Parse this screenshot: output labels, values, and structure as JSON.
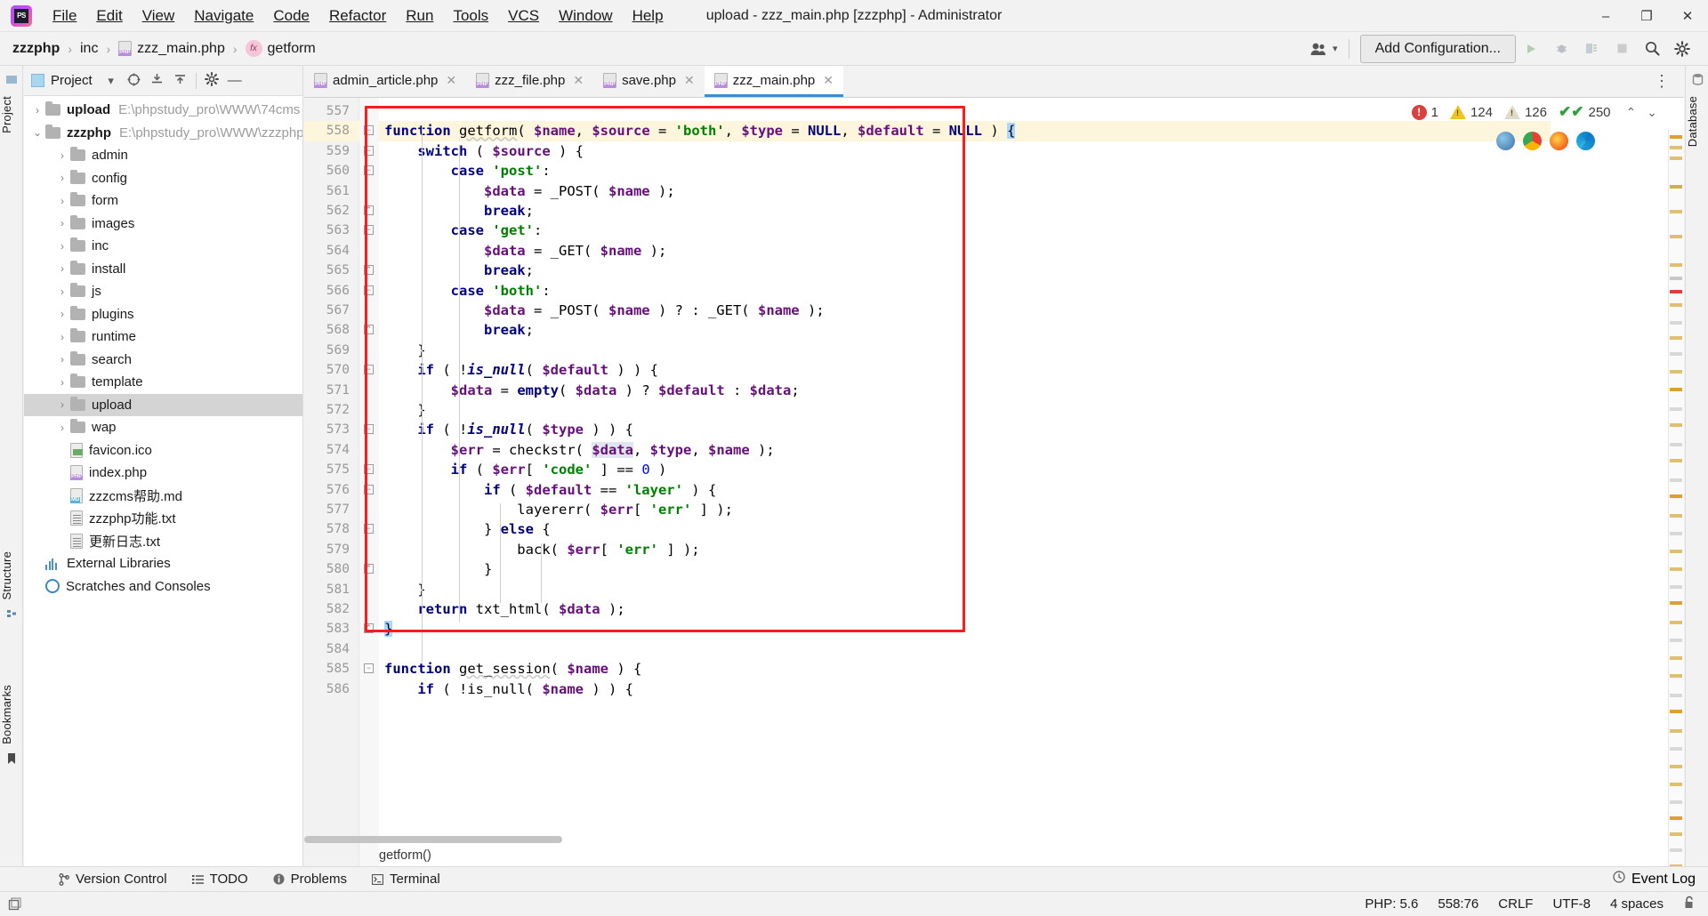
{
  "window": {
    "title": "upload - zzz_main.php [zzzphp] - Administrator",
    "logo_text": "PS",
    "minimize": "–",
    "maximize": "❐",
    "close": "✕"
  },
  "menu": [
    {
      "label": "File"
    },
    {
      "label": "Edit"
    },
    {
      "label": "View"
    },
    {
      "label": "Navigate"
    },
    {
      "label": "Code"
    },
    {
      "label": "Refactor"
    },
    {
      "label": "Run"
    },
    {
      "label": "Tools"
    },
    {
      "label": "VCS"
    },
    {
      "label": "Window"
    },
    {
      "label": "Help"
    }
  ],
  "navbar": {
    "breadcrumbs": [
      {
        "label": "zzzphp",
        "icon": "",
        "bold": true
      },
      {
        "label": "inc",
        "icon": ""
      },
      {
        "label": "zzz_main.php",
        "icon": "php-file-icon"
      },
      {
        "label": "getform",
        "icon": "function-icon"
      }
    ],
    "separator": "›",
    "people_icon": "👥",
    "people_chevron": "▾",
    "add_configuration": "Add Configuration...",
    "run_icon": "▶",
    "debug_icon": "🐞",
    "coverage_icon": "▤",
    "stop_icon": "■",
    "search_icon": "🔍",
    "settings_icon": "⚙"
  },
  "rail_left": {
    "project_label": "Project",
    "structure_label": "Structure",
    "bookmarks_label": "Bookmarks",
    "structure_icon": "☰",
    "bookmarks_icon": "🔖"
  },
  "rail_right": {
    "database_label": "Database"
  },
  "project_panel": {
    "title": "Project",
    "chevron": "▾",
    "icons": {
      "locate": "⊕",
      "expand": "⩟",
      "collapse": "⩠",
      "gear": "⚙",
      "hide": "—"
    },
    "tree": [
      {
        "label": "upload",
        "path": "E:\\phpstudy_pro\\WWW\\74cms",
        "type": "root-folder",
        "twist": "›",
        "depth": 0,
        "bold": true
      },
      {
        "label": "zzzphp",
        "path": "E:\\phpstudy_pro\\WWW\\zzzphp",
        "type": "root-folder",
        "twist": "⌄",
        "depth": 0,
        "bold": true
      },
      {
        "label": "admin",
        "type": "folder",
        "twist": "›",
        "depth": 1
      },
      {
        "label": "config",
        "type": "folder",
        "twist": "›",
        "depth": 1
      },
      {
        "label": "form",
        "type": "folder",
        "twist": "›",
        "depth": 1
      },
      {
        "label": "images",
        "type": "folder",
        "twist": "›",
        "depth": 1
      },
      {
        "label": "inc",
        "type": "folder",
        "twist": "›",
        "depth": 1
      },
      {
        "label": "install",
        "type": "folder",
        "twist": "›",
        "depth": 1
      },
      {
        "label": "js",
        "type": "folder",
        "twist": "›",
        "depth": 1
      },
      {
        "label": "plugins",
        "type": "folder",
        "twist": "›",
        "depth": 1
      },
      {
        "label": "runtime",
        "type": "folder",
        "twist": "›",
        "depth": 1
      },
      {
        "label": "search",
        "type": "folder",
        "twist": "›",
        "depth": 1
      },
      {
        "label": "template",
        "type": "folder",
        "twist": "›",
        "depth": 1
      },
      {
        "label": "upload",
        "type": "folder",
        "twist": "›",
        "depth": 1,
        "selected": true
      },
      {
        "label": "wap",
        "type": "folder",
        "twist": "›",
        "depth": 1
      },
      {
        "label": "favicon.ico",
        "type": "file-img",
        "ext": "",
        "depth": 1
      },
      {
        "label": "index.php",
        "type": "file-php",
        "ext": "PHP",
        "depth": 1
      },
      {
        "label": "zzzcms帮助.md",
        "type": "file-md",
        "ext": "MD",
        "depth": 1
      },
      {
        "label": "zzzphp功能.txt",
        "type": "file-txt",
        "ext": "",
        "depth": 1
      },
      {
        "label": "更新日志.txt",
        "type": "file-txt",
        "ext": "",
        "depth": 1
      },
      {
        "label": "External Libraries",
        "type": "libraries",
        "depth": 0
      },
      {
        "label": "Scratches and Consoles",
        "type": "scratches",
        "depth": 0
      }
    ]
  },
  "tabs": [
    {
      "label": "admin_article.php",
      "icon": "php-file-icon",
      "close": "✕",
      "active": false
    },
    {
      "label": "zzz_file.php",
      "icon": "php-file-icon",
      "close": "✕",
      "active": false
    },
    {
      "label": "save.php",
      "icon": "php-file-icon",
      "close": "✕",
      "active": false
    },
    {
      "label": "zzz_main.php",
      "icon": "php-file-icon",
      "close": "✕",
      "active": true
    }
  ],
  "tabbar_more_icon": "⋮",
  "inspection_widget": {
    "error_icon": "!",
    "errors": "1",
    "warning_icon": "▲",
    "warnings": "124",
    "weak_warning_icon": "▲",
    "weak_warnings": "126",
    "ok_icon": "✔✔",
    "typos": "250",
    "prev_icon": "⌃",
    "next_icon": "⌄"
  },
  "browser_icons": [
    "ie-icon",
    "chrome-icon",
    "firefox-icon",
    "edge-icon"
  ],
  "editor": {
    "first_line_number": 557,
    "lines": [
      {
        "n": 557,
        "tokens": []
      },
      {
        "n": 558,
        "highlight": true,
        "tokens": [
          {
            "t": "function ",
            "c": "k"
          },
          {
            "t": "getform",
            "c": "fu"
          },
          {
            "t": "( ",
            "c": "p"
          },
          {
            "t": "$name",
            "c": "v"
          },
          {
            "t": ", ",
            "c": "p"
          },
          {
            "t": "$source",
            "c": "v"
          },
          {
            "t": " = ",
            "c": "p"
          },
          {
            "t": "'both'",
            "c": "s"
          },
          {
            "t": ", ",
            "c": "p"
          },
          {
            "t": "$type",
            "c": "v"
          },
          {
            "t": " = ",
            "c": "p"
          },
          {
            "t": "NULL",
            "c": "k"
          },
          {
            "t": ", ",
            "c": "p"
          },
          {
            "t": "$default",
            "c": "v"
          },
          {
            "t": " = ",
            "c": "p"
          },
          {
            "t": "NULL",
            "c": "k"
          },
          {
            "t": " ) ",
            "c": "p"
          },
          {
            "t": "{",
            "c": "curly-hl"
          }
        ]
      },
      {
        "n": 559,
        "tokens": [
          {
            "t": "    ",
            "c": "p"
          },
          {
            "t": "switch",
            "c": "k"
          },
          {
            "t": " ( ",
            "c": "p"
          },
          {
            "t": "$source",
            "c": "v"
          },
          {
            "t": " ) {",
            "c": "p"
          }
        ]
      },
      {
        "n": 560,
        "tokens": [
          {
            "t": "        ",
            "c": "p"
          },
          {
            "t": "case",
            "c": "k"
          },
          {
            "t": " ",
            "c": "p"
          },
          {
            "t": "'post'",
            "c": "s"
          },
          {
            "t": ":",
            "c": "p"
          }
        ]
      },
      {
        "n": 561,
        "tokens": [
          {
            "t": "            ",
            "c": "p"
          },
          {
            "t": "$data",
            "c": "v"
          },
          {
            "t": " = _POST( ",
            "c": "p"
          },
          {
            "t": "$name",
            "c": "v"
          },
          {
            "t": " );",
            "c": "p"
          }
        ]
      },
      {
        "n": 562,
        "tokens": [
          {
            "t": "            ",
            "c": "p"
          },
          {
            "t": "break",
            "c": "k"
          },
          {
            "t": ";",
            "c": "p"
          }
        ]
      },
      {
        "n": 563,
        "tokens": [
          {
            "t": "        ",
            "c": "p"
          },
          {
            "t": "case",
            "c": "k"
          },
          {
            "t": " ",
            "c": "p"
          },
          {
            "t": "'get'",
            "c": "s"
          },
          {
            "t": ":",
            "c": "p"
          }
        ]
      },
      {
        "n": 564,
        "tokens": [
          {
            "t": "            ",
            "c": "p"
          },
          {
            "t": "$data",
            "c": "v"
          },
          {
            "t": " = _GET( ",
            "c": "p"
          },
          {
            "t": "$name",
            "c": "v"
          },
          {
            "t": " );",
            "c": "p"
          }
        ]
      },
      {
        "n": 565,
        "tokens": [
          {
            "t": "            ",
            "c": "p"
          },
          {
            "t": "break",
            "c": "k"
          },
          {
            "t": ";",
            "c": "p"
          }
        ]
      },
      {
        "n": 566,
        "tokens": [
          {
            "t": "        ",
            "c": "p"
          },
          {
            "t": "case",
            "c": "k"
          },
          {
            "t": " ",
            "c": "p"
          },
          {
            "t": "'both'",
            "c": "s"
          },
          {
            "t": ":",
            "c": "p"
          }
        ]
      },
      {
        "n": 567,
        "tokens": [
          {
            "t": "            ",
            "c": "p"
          },
          {
            "t": "$data",
            "c": "v"
          },
          {
            "t": " = _POST( ",
            "c": "p"
          },
          {
            "t": "$name",
            "c": "v"
          },
          {
            "t": " ) ? : _GET( ",
            "c": "p"
          },
          {
            "t": "$name",
            "c": "v"
          },
          {
            "t": " );",
            "c": "p"
          }
        ]
      },
      {
        "n": 568,
        "tokens": [
          {
            "t": "            ",
            "c": "p"
          },
          {
            "t": "break",
            "c": "k"
          },
          {
            "t": ";",
            "c": "p"
          }
        ]
      },
      {
        "n": 569,
        "tokens": [
          {
            "t": "    }",
            "c": "p"
          }
        ]
      },
      {
        "n": 570,
        "tokens": [
          {
            "t": "    ",
            "c": "p"
          },
          {
            "t": "if",
            "c": "k"
          },
          {
            "t": " ( !",
            "c": "p"
          },
          {
            "t": "is_null",
            "c": "fi"
          },
          {
            "t": "( ",
            "c": "p"
          },
          {
            "t": "$default",
            "c": "v"
          },
          {
            "t": " ) ) {",
            "c": "p"
          }
        ]
      },
      {
        "n": 571,
        "tokens": [
          {
            "t": "        ",
            "c": "p"
          },
          {
            "t": "$data",
            "c": "v"
          },
          {
            "t": " = ",
            "c": "p"
          },
          {
            "t": "empty",
            "c": "k"
          },
          {
            "t": "( ",
            "c": "p"
          },
          {
            "t": "$data",
            "c": "v"
          },
          {
            "t": " ) ? ",
            "c": "p"
          },
          {
            "t": "$default",
            "c": "v"
          },
          {
            "t": " : ",
            "c": "p"
          },
          {
            "t": "$data",
            "c": "v"
          },
          {
            "t": ";",
            "c": "p"
          }
        ]
      },
      {
        "n": 572,
        "tokens": [
          {
            "t": "    }",
            "c": "p"
          }
        ]
      },
      {
        "n": 573,
        "tokens": [
          {
            "t": "    ",
            "c": "p"
          },
          {
            "t": "if",
            "c": "k"
          },
          {
            "t": " ( !",
            "c": "p"
          },
          {
            "t": "is_null",
            "c": "fi"
          },
          {
            "t": "( ",
            "c": "p"
          },
          {
            "t": "$type",
            "c": "v"
          },
          {
            "t": " ) ) {",
            "c": "p"
          }
        ]
      },
      {
        "n": 574,
        "tokens": [
          {
            "t": "        ",
            "c": "p"
          },
          {
            "t": "$err",
            "c": "v"
          },
          {
            "t": " = checkstr( ",
            "c": "p"
          },
          {
            "t": "$data",
            "c": "hlv"
          },
          {
            "t": ", ",
            "c": "p"
          },
          {
            "t": "$type",
            "c": "v"
          },
          {
            "t": ", ",
            "c": "p"
          },
          {
            "t": "$name",
            "c": "v"
          },
          {
            "t": " );",
            "c": "p"
          }
        ]
      },
      {
        "n": 575,
        "tokens": [
          {
            "t": "        ",
            "c": "p"
          },
          {
            "t": "if",
            "c": "k"
          },
          {
            "t": " ( ",
            "c": "p"
          },
          {
            "t": "$err",
            "c": "v"
          },
          {
            "t": "[ ",
            "c": "p"
          },
          {
            "t": "'code'",
            "c": "s"
          },
          {
            "t": " ] == ",
            "c": "p"
          },
          {
            "t": "0",
            "c": "n"
          },
          {
            "t": " )",
            "c": "p"
          }
        ]
      },
      {
        "n": 576,
        "tokens": [
          {
            "t": "            ",
            "c": "p"
          },
          {
            "t": "if",
            "c": "k"
          },
          {
            "t": " ( ",
            "c": "p"
          },
          {
            "t": "$default",
            "c": "v"
          },
          {
            "t": " == ",
            "c": "p"
          },
          {
            "t": "'layer'",
            "c": "s"
          },
          {
            "t": " ) {",
            "c": "p"
          }
        ]
      },
      {
        "n": 577,
        "tokens": [
          {
            "t": "                layererr( ",
            "c": "p"
          },
          {
            "t": "$err",
            "c": "v"
          },
          {
            "t": "[ ",
            "c": "p"
          },
          {
            "t": "'err'",
            "c": "s"
          },
          {
            "t": " ] );",
            "c": "p"
          }
        ]
      },
      {
        "n": 578,
        "tokens": [
          {
            "t": "            } ",
            "c": "p"
          },
          {
            "t": "else",
            "c": "k"
          },
          {
            "t": " {",
            "c": "p"
          }
        ]
      },
      {
        "n": 579,
        "tokens": [
          {
            "t": "                back( ",
            "c": "p"
          },
          {
            "t": "$err",
            "c": "v"
          },
          {
            "t": "[ ",
            "c": "p"
          },
          {
            "t": "'err'",
            "c": "s"
          },
          {
            "t": " ] );",
            "c": "p"
          }
        ]
      },
      {
        "n": 580,
        "tokens": [
          {
            "t": "            }",
            "c": "p"
          }
        ]
      },
      {
        "n": 581,
        "tokens": [
          {
            "t": "    }",
            "c": "p"
          }
        ]
      },
      {
        "n": 582,
        "tokens": [
          {
            "t": "    ",
            "c": "p"
          },
          {
            "t": "return",
            "c": "k"
          },
          {
            "t": " txt_html( ",
            "c": "p"
          },
          {
            "t": "$data",
            "c": "v"
          },
          {
            "t": " );",
            "c": "p"
          }
        ]
      },
      {
        "n": 583,
        "tokens": [
          {
            "t": "}",
            "c": "curly-hl"
          }
        ]
      },
      {
        "n": 584,
        "tokens": []
      },
      {
        "n": 585,
        "tokens": [
          {
            "t": "function ",
            "c": "k"
          },
          {
            "t": "get_session",
            "c": "fu"
          },
          {
            "t": "( ",
            "c": "p"
          },
          {
            "t": "$name",
            "c": "v"
          },
          {
            "t": " ) {",
            "c": "p"
          }
        ]
      },
      {
        "n": 586,
        "tokens": [
          {
            "t": "    ",
            "c": "p"
          },
          {
            "t": "if",
            "c": "k"
          },
          {
            "t": " ( ",
            "c": "p"
          },
          {
            "t": "!is_null( ",
            "c": "p"
          },
          {
            "t": "$name",
            "c": "v"
          },
          {
            "t": " ) ) {",
            "c": "p"
          }
        ]
      }
    ],
    "bottom_breadcrumb": "getform()"
  },
  "annotation": {
    "color": "#ff1b1b",
    "target": "getform-function-block"
  },
  "tool_window_bar": {
    "items": [
      {
        "label": "Version Control",
        "icon": "branch-icon"
      },
      {
        "label": "TODO",
        "icon": "list-icon"
      },
      {
        "label": "Problems",
        "icon": "info-icon"
      },
      {
        "label": "Terminal",
        "icon": "terminal-icon"
      }
    ],
    "event_log": {
      "label": "Event Log",
      "icon": "bell-icon"
    }
  },
  "statusbar": {
    "memory_icon": "❐",
    "php_version": "PHP: 5.6",
    "caret_position": "558:76",
    "line_separator": "CRLF",
    "encoding": "UTF-8",
    "indent": "4 spaces",
    "lock_icon": "🔓"
  }
}
